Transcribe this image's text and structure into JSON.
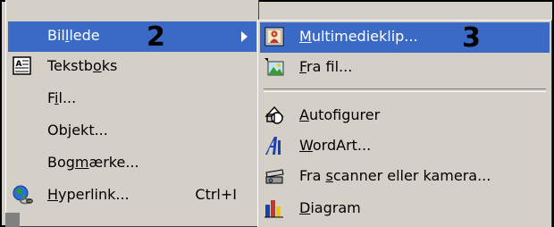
{
  "left_menu": {
    "items": [
      {
        "label_pre": "Bil",
        "label_key": "l",
        "label_post": "lede",
        "annotation": "2",
        "has_submenu": true,
        "highlighted": true,
        "icon": ""
      },
      {
        "label_pre": "Tekstb",
        "label_key": "o",
        "label_post": "ks",
        "icon": "textbox-icon"
      },
      {
        "label_pre": "F",
        "label_key": "i",
        "label_post": "l...",
        "icon": ""
      },
      {
        "label_pre": "Ob",
        "label_key": "j",
        "label_post": "ekt...",
        "icon": ""
      },
      {
        "label_pre": "Bog",
        "label_key": "m",
        "label_post": "ærke...",
        "icon": ""
      },
      {
        "label_pre": "",
        "label_key": "H",
        "label_post": "yperlink...",
        "shortcut": "Ctrl+I",
        "icon": "hyperlink-globe-icon"
      }
    ]
  },
  "right_menu": {
    "items": [
      {
        "label_pre": "",
        "label_key": "M",
        "label_post": "ultimedieklip...",
        "annotation": "3",
        "highlighted": true,
        "icon": "clipart-icon"
      },
      {
        "label_pre": "",
        "label_key": "F",
        "label_post": "ra fil...",
        "icon": "picture-file-icon"
      },
      {
        "label_pre": "",
        "label_key": "A",
        "label_post": "utofigurer",
        "icon": "autoshapes-icon"
      },
      {
        "label_pre": "",
        "label_key": "W",
        "label_post": "ordArt...",
        "icon": "wordart-icon"
      },
      {
        "label_pre": "Fra ",
        "label_key": "s",
        "label_post": "canner eller kamera...",
        "icon": "scanner-icon"
      },
      {
        "label_pre": "",
        "label_key": "D",
        "label_post": "iagram",
        "icon": "chart-icon"
      }
    ]
  },
  "colors": {
    "menu_bg": "#d4d0c8",
    "highlight": "#3a6ac5",
    "highlight_text": "#ffffff"
  }
}
